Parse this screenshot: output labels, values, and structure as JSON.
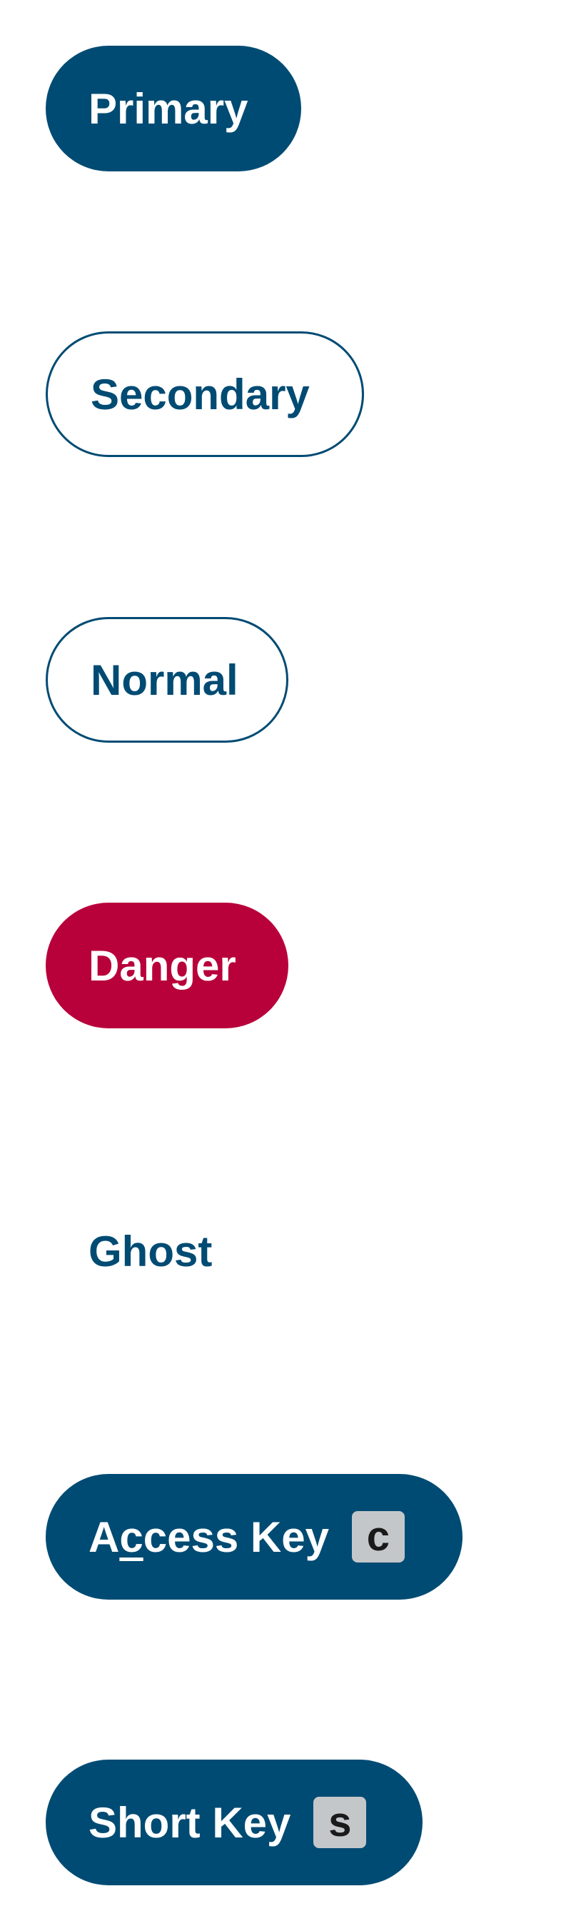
{
  "buttons": {
    "primary": {
      "label": "Primary"
    },
    "secondary": {
      "label": "Secondary"
    },
    "normal": {
      "label": "Normal"
    },
    "danger": {
      "label": "Danger"
    },
    "ghost": {
      "label": "Ghost"
    },
    "access_key": {
      "label_before": "A",
      "label_accent": "c",
      "label_after": "cess Key",
      "key": "c"
    },
    "short_key": {
      "label": "Short Key",
      "key": "s"
    }
  },
  "colors": {
    "brand": "#004b73",
    "danger": "#b8003a",
    "key_badge_bg": "#c4c7ca",
    "background": "#ffffff"
  }
}
